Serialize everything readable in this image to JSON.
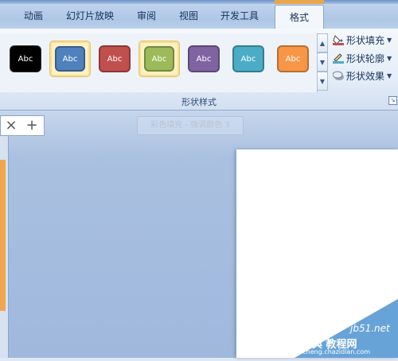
{
  "tabs": [
    {
      "label": "动画"
    },
    {
      "label": "幻灯片放映"
    },
    {
      "label": "审阅"
    },
    {
      "label": "视图"
    },
    {
      "label": "开发工具"
    },
    {
      "label": "格式",
      "active": true
    }
  ],
  "gallery": {
    "items": [
      {
        "label": "Abc",
        "color": "#000000",
        "border": "#333333"
      },
      {
        "label": "Abc",
        "color": "#4f81bd",
        "border": "#385d8a"
      },
      {
        "label": "Abc",
        "color": "#c0504d",
        "border": "#8c3836"
      },
      {
        "label": "Abc",
        "color": "#9bbb59",
        "border": "#71893f"
      },
      {
        "label": "Abc",
        "color": "#8064a2",
        "border": "#5c4776"
      },
      {
        "label": "Abc",
        "color": "#4bacc6",
        "border": "#357d91"
      },
      {
        "label": "Abc",
        "color": "#f79646",
        "border": "#b66d31"
      }
    ],
    "selected_index": 3,
    "hovered_index": 1,
    "scroll_up": "▲",
    "scroll_down": "▼",
    "more": "▼"
  },
  "commands": {
    "fill": "形状填充",
    "outline": "形状轮廓",
    "effects": "形状效果",
    "dropdown": "▼"
  },
  "group_label": "形状样式",
  "launcher": "↘",
  "panel_tabs": {
    "close": "×",
    "add": "+"
  },
  "tooltip": "彩色填充 - 强调颜色 3",
  "watermark": {
    "site": "jb51.net",
    "line1": "查字典 教程网",
    "line2": "jiaocheng.chazidian.com"
  },
  "colors": {
    "accent_tab": "#e9a64a",
    "ribbon": "#dfe8f5",
    "fill_icon": "#c0504d",
    "outline_icon": "#4bacc6"
  }
}
